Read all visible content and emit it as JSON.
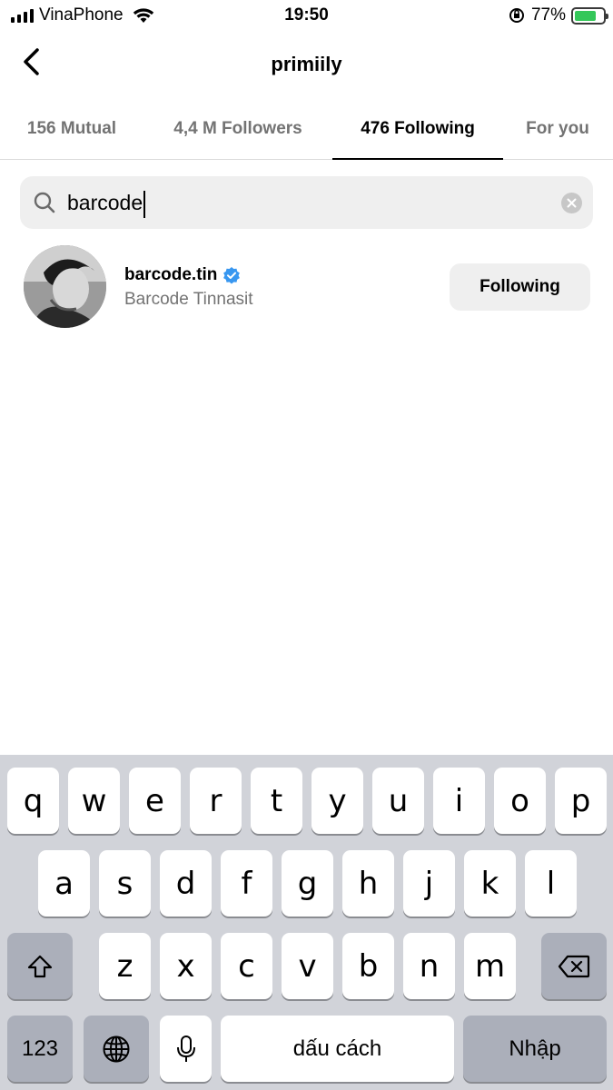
{
  "status_bar": {
    "carrier": "VinaPhone",
    "time": "19:50",
    "battery_percent": "77%",
    "battery_level": 0.77
  },
  "header": {
    "title": "primiily"
  },
  "tabs": [
    {
      "label": "156 Mutual",
      "active": false
    },
    {
      "label": "4,4 M Followers",
      "active": false
    },
    {
      "label": "476 Following",
      "active": true
    },
    {
      "label": "For you",
      "active": false
    }
  ],
  "search": {
    "value": "barcode"
  },
  "results": [
    {
      "username": "barcode.tin",
      "full_name": "Barcode Tinnasit",
      "verified": true,
      "button_label": "Following"
    }
  ],
  "keyboard": {
    "row1": [
      "q",
      "w",
      "e",
      "r",
      "t",
      "y",
      "u",
      "i",
      "o",
      "p"
    ],
    "row2": [
      "a",
      "s",
      "d",
      "f",
      "g",
      "h",
      "j",
      "k",
      "l"
    ],
    "row3": [
      "z",
      "x",
      "c",
      "v",
      "b",
      "n",
      "m"
    ],
    "numbers_key": "123",
    "space_key": "dấu cách",
    "return_key": "Nhập"
  },
  "colors": {
    "verified_badge": "#3897f0",
    "battery_fill": "#34c759",
    "keyboard_bg": "#d1d3d9"
  }
}
